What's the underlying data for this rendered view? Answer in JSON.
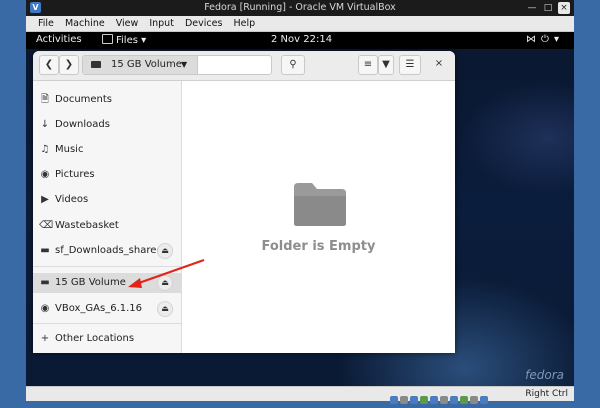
{
  "vbox": {
    "title": "Fedora [Running] - Oracle VM VirtualBox",
    "menu": [
      "File",
      "Machine",
      "View",
      "Input",
      "Devices",
      "Help"
    ],
    "status_host_key": "Right Ctrl"
  },
  "gnome": {
    "activities": "Activities",
    "app_menu": "Files ▾",
    "clock": "2 Nov  22:14",
    "brand": "fedora"
  },
  "files": {
    "path_segment": "15 GB Volume",
    "sidebar": [
      {
        "label": "Documents",
        "icon": "document-icon"
      },
      {
        "label": "Downloads",
        "icon": "download-icon"
      },
      {
        "label": "Music",
        "icon": "music-icon"
      },
      {
        "label": "Pictures",
        "icon": "camera-icon"
      },
      {
        "label": "Videos",
        "icon": "video-icon"
      },
      {
        "label": "Wastebasket",
        "icon": "trash-icon"
      },
      {
        "label": "sf_Downloads_shared",
        "icon": "drive-icon"
      },
      {
        "label": "15 GB Volume",
        "icon": "drive-icon"
      },
      {
        "label": "VBox_GAs_6.1.16",
        "icon": "disc-icon"
      },
      {
        "label": "Other Locations",
        "icon": "plus-icon"
      }
    ],
    "empty_message": "Folder is Empty"
  },
  "colors": {
    "annotation_arrow": "#e2231a",
    "guest_background": "#0b1d3c"
  }
}
